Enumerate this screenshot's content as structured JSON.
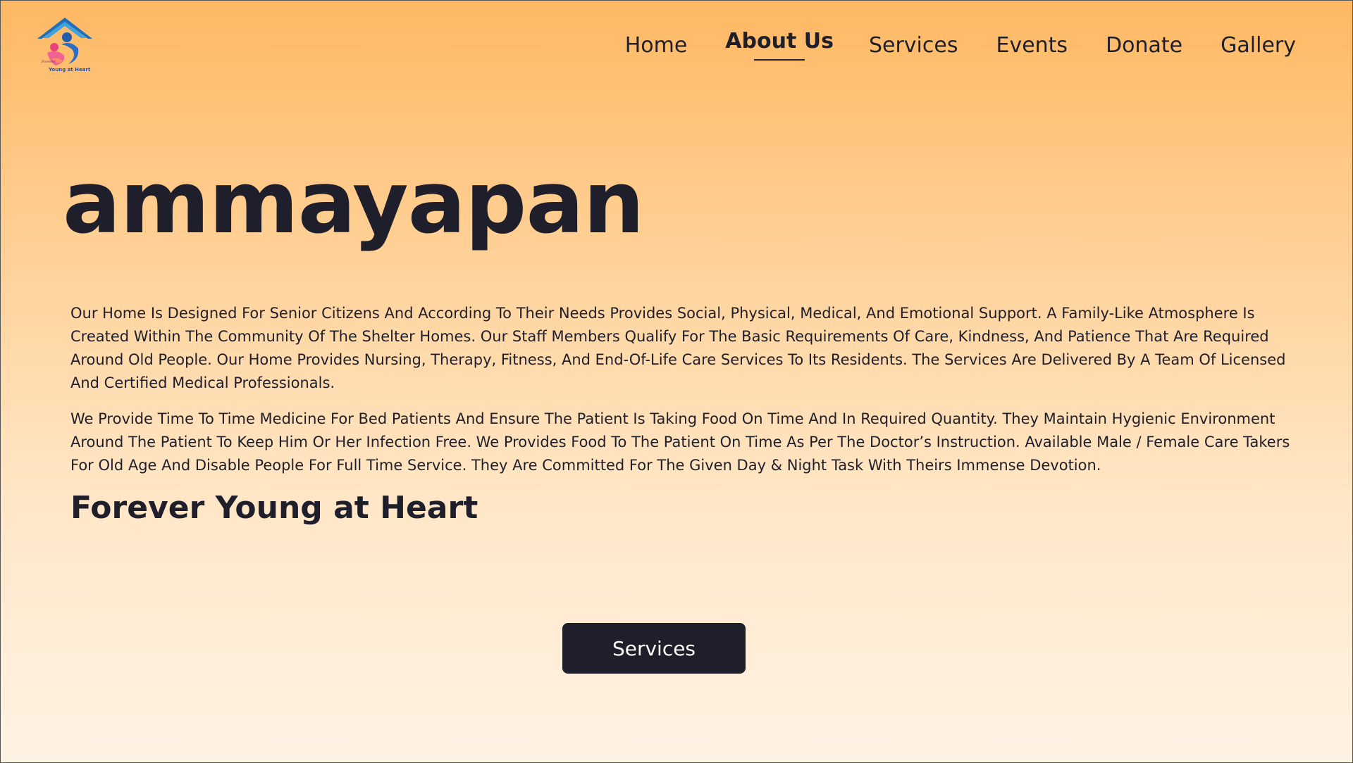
{
  "logo": {
    "text": "Young at Heart",
    "icon": "house-family-logo-icon"
  },
  "nav": {
    "items": [
      {
        "label": "Home",
        "active": false
      },
      {
        "label": "About Us",
        "active": true
      },
      {
        "label": "Services",
        "active": false
      },
      {
        "label": "Events",
        "active": false
      },
      {
        "label": "Donate",
        "active": false
      },
      {
        "label": "Gallery",
        "active": false
      }
    ]
  },
  "hero": {
    "title": "ammayapan"
  },
  "about": {
    "paragraph1": "Our Home Is Designed For Senior Citizens And According To Their Needs Provides Social, Physical, Medical, And Emotional Support. A Family-Like Atmosphere Is Created Within The Community Of The Shelter Homes. Our Staff Members Qualify For The Basic Requirements Of Care, Kindness, And Patience That Are Required Around Old People. Our Home Provides Nursing, Therapy, Fitness, And End-Of-Life Care Services To Its Residents. The Services Are Delivered By A Team Of Licensed And Certified Medical Professionals.",
    "paragraph2": "We Provide Time To Time Medicine For Bed Patients And Ensure The Patient Is Taking Food On Time And In Required Quantity. They Maintain Hygienic Environment Around The Patient To Keep Him Or Her Infection Free. We Provides Food To The Patient On Time As Per The Doctor’s Instruction. Available Male / Female Care Takers For Old Age And Disable People For Full Time Service. They Are Committed For The Given Day & Night Task With Theirs Immense Devotion.",
    "tagline": "Forever Young at Heart"
  },
  "cta": {
    "label": "Services"
  },
  "colors": {
    "gradient_top": "#ffb863",
    "gradient_bottom": "#fff3e4",
    "text_dark": "#1f1f2b",
    "button_bg": "#1f1f2b",
    "button_text": "#ffffff"
  }
}
